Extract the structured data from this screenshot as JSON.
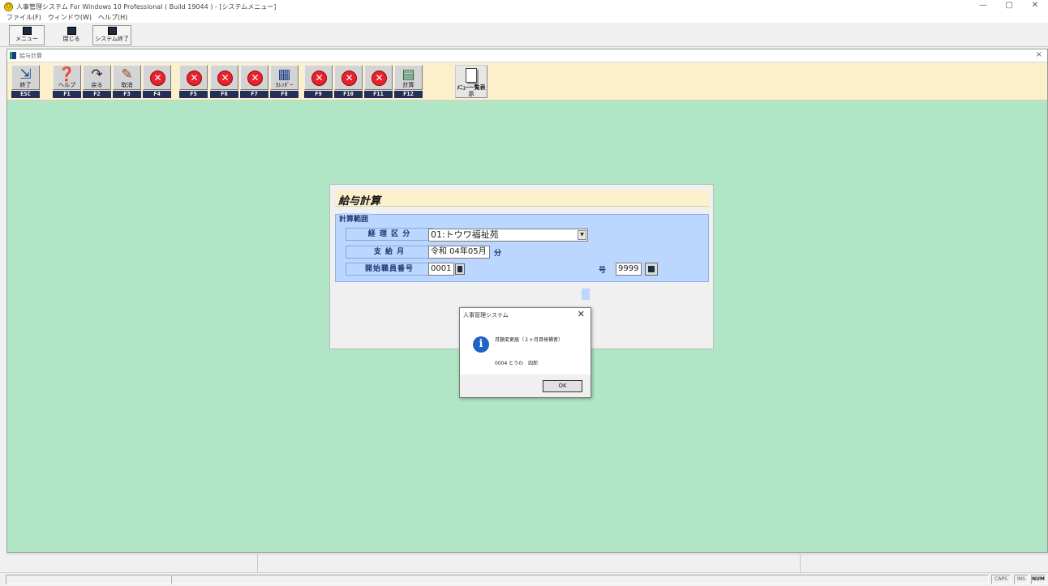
{
  "app": {
    "title": "人事管理システム For Windows 10 Professional ( Build 19044 ) - [システムメニュー]",
    "window_controls": [
      "—",
      "▢",
      "✕"
    ]
  },
  "menubar": {
    "file": "ファイル(F)",
    "window": "ウィンドウ(W)",
    "help": "ヘルプ(H)"
  },
  "app_toolbar": {
    "menu": "メニュー",
    "close": "閉じる",
    "exit_system": "システム終了"
  },
  "child_window": {
    "title": "給与計算",
    "close": "×"
  },
  "fkey_toolbar": {
    "buttons": [
      {
        "key": "ESC",
        "label": "終了",
        "icon": "exit-icon"
      },
      {
        "key": "F1",
        "label": "ヘルプ",
        "icon": "help-icon"
      },
      {
        "key": "F2",
        "label": "戻る",
        "icon": "back-arrow-icon"
      },
      {
        "key": "F3",
        "label": "取消",
        "icon": "cancel-pencil-icon"
      },
      {
        "key": "F4",
        "label": "",
        "icon": "disabled-x-icon"
      },
      {
        "key": "F5",
        "label": "",
        "icon": "disabled-x-icon"
      },
      {
        "key": "F6",
        "label": "",
        "icon": "disabled-x-icon"
      },
      {
        "key": "F7",
        "label": "",
        "icon": "disabled-x-icon"
      },
      {
        "key": "F8",
        "label": "ｶﾚﾝﾀﾞｰ",
        "icon": "calendar-icon"
      },
      {
        "key": "F9",
        "label": "",
        "icon": "disabled-x-icon"
      },
      {
        "key": "F10",
        "label": "",
        "icon": "disabled-x-icon"
      },
      {
        "key": "F11",
        "label": "",
        "icon": "disabled-x-icon"
      },
      {
        "key": "F12",
        "label": "計算",
        "icon": "calculator-icon"
      }
    ],
    "menu_list_label": "ﾒﾆｭｰ一覧表示"
  },
  "form": {
    "title": "給与計算",
    "group_legend": "計算範囲",
    "dept_label": "経 理 区 分",
    "dept_value": "01:トウワ福祉苑",
    "month_label": "支 給 月",
    "month_value": "令和 04年05月",
    "month_suffix": "分",
    "start_emp_label": "開始職員番号",
    "start_emp_value": "0001",
    "end_emp_label_fragment": "号",
    "end_emp_value": "9999"
  },
  "msgbox": {
    "title": "人事管理システム",
    "close": "✕",
    "line1": "月額変更届（２ヶ月目候補者）",
    "line2": "0004 とうわ　四郎",
    "ok": "OK"
  },
  "statusbar": {
    "caps": "CAPS",
    "ins": "INS",
    "num": "NUM"
  }
}
